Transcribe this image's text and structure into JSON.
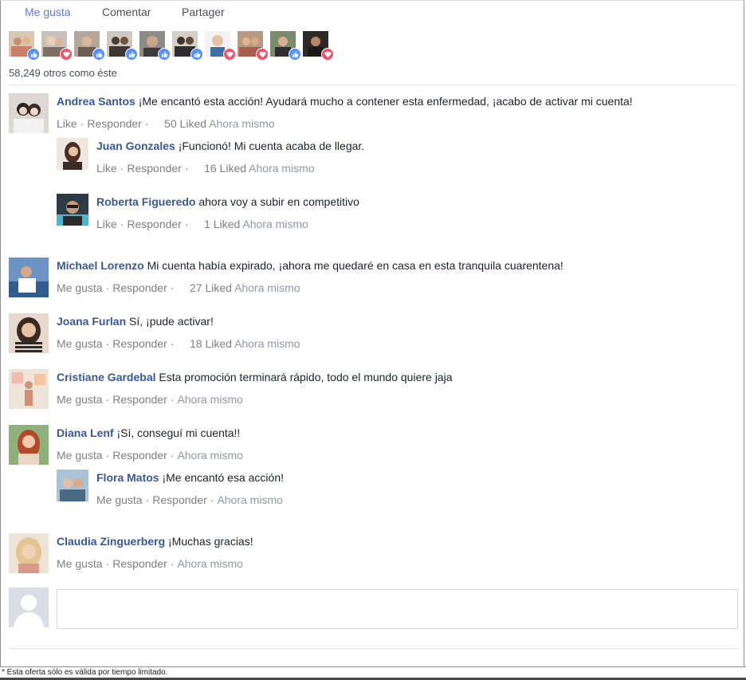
{
  "action_bar": {
    "like": "Me gusta",
    "comment": "Comentar",
    "share": "Partager"
  },
  "reactions": [
    {
      "icon": "like-icon",
      "color": "#5890ff"
    },
    {
      "icon": "heart-icon",
      "color": "#f25268"
    },
    {
      "icon": "like-icon",
      "color": "#5890ff"
    },
    {
      "icon": "like-icon",
      "color": "#5890ff"
    },
    {
      "icon": "like-icon",
      "color": "#5890ff"
    },
    {
      "icon": "like-icon",
      "color": "#5890ff"
    },
    {
      "icon": "heart-icon",
      "color": "#f25268"
    },
    {
      "icon": "heart-icon",
      "color": "#f25268"
    },
    {
      "icon": "like-icon",
      "color": "#5890ff"
    },
    {
      "icon": "heart-icon",
      "color": "#f25268"
    }
  ],
  "others_count": "58,249 otros como éste",
  "comments": [
    {
      "name": "Andrea Santos",
      "text": "¡Me encantó esta acción! Ayudará mucho a contener esta enfermedad, ¡acabo de activar mi cuenta!",
      "like": "Like",
      "reply": "Responder",
      "liked": "50 Liked",
      "time": "Ahora mismo"
    },
    {
      "name": "Juan Gonzales",
      "text": "¡Funcionó! Mi cuenta acaba de llegar.",
      "like": "Like",
      "reply": "Responder",
      "liked": "16 Liked",
      "time": "Ahora mismo"
    },
    {
      "name": "Roberta Figueredo",
      "text": "ahora voy a subir en competitivo",
      "like": "Like",
      "reply": "Responder",
      "liked": "1 Liked",
      "time": "Ahora mismo"
    },
    {
      "name": "Michael Lorenzo",
      "text": "Mi cuenta había expirado, ¡ahora me quedaré en casa en esta tranquila cuarentena!",
      "like": "Me gusta",
      "reply": "Responder",
      "liked": "27 Liked",
      "time": "Ahora mismo"
    },
    {
      "name": "Joana Furlan",
      "text": "Sí, ¡pude activar!",
      "like": "Me gusta",
      "reply": "Responder",
      "liked": "18 Liked",
      "time": "Ahora mismo"
    },
    {
      "name": "Cristiane Gardebal",
      "text": "Esta promoción terminará rápido, todo el mundo quiere jaja",
      "like": "Me gusta",
      "reply": "Responder",
      "liked": "",
      "time": "Ahora mismo"
    },
    {
      "name": "Diana Lenf",
      "text": "¡Sí, conseguí mi cuenta!!",
      "like": "Me gusta",
      "reply": "Responder",
      "liked": "",
      "time": "Ahora mismo"
    },
    {
      "name": "Flora Matos",
      "text": "¡Me encantó esa acción!",
      "like": "Me gusta",
      "reply": "Responder",
      "liked": "",
      "time": "Ahora mismo"
    },
    {
      "name": "Claudia Zinguerberg",
      "text": "¡Muchas gracias!",
      "like": "Me gusta",
      "reply": "Responder",
      "liked": "",
      "time": "Ahora mismo"
    }
  ],
  "compose": {
    "placeholder": ""
  },
  "footer": "* Esta oferta sólo es válida por tiempo limitado.",
  "colors": {
    "accent": "#5b7bd5",
    "name": "#365899",
    "muted": "#7f7f7f"
  }
}
